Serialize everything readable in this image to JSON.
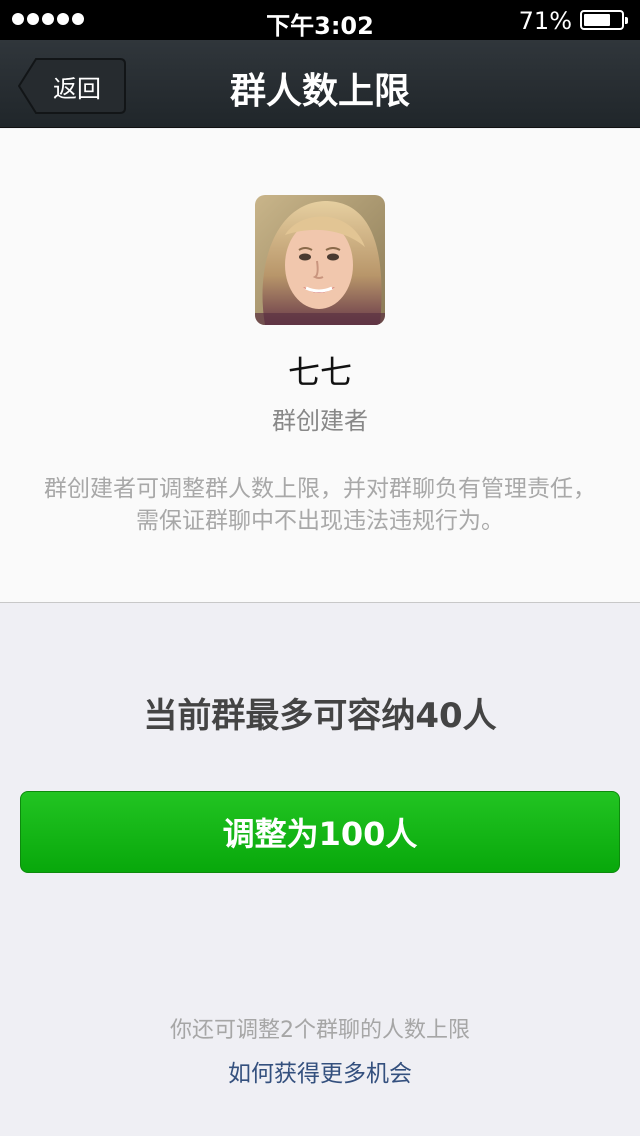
{
  "status_bar": {
    "time": "下午3:02",
    "battery_percent": "71%",
    "battery_level": 0.71
  },
  "nav": {
    "back_label": "返回",
    "title": "群人数上限"
  },
  "owner": {
    "name": "七七",
    "role": "群创建者",
    "notice": "群创建者可调整群人数上限，并对群聊负有管理责任，需保证群聊中不出现违法违规行为。"
  },
  "capacity": {
    "current_text": "当前群最多可容纳40人",
    "adjust_button_label": "调整为100人",
    "remaining_text": "你还可调整2个群聊的人数上限",
    "more_link": "如何获得更多机会"
  },
  "colors": {
    "button_green": "#1db81d",
    "link_blue": "#34507e",
    "nav_background": "#262c30"
  }
}
